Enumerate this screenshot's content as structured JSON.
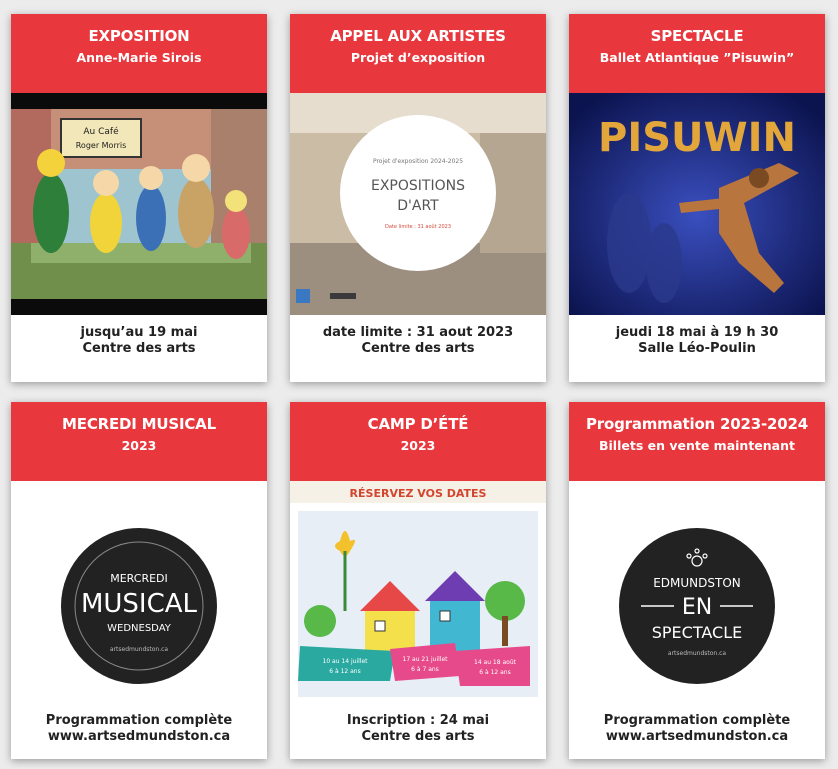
{
  "colors": {
    "header_red": "#e8373d",
    "background": "#ececec"
  },
  "cards": [
    {
      "title": "EXPOSITION",
      "subtitle": "Anne-Marie Sirois",
      "footer": [
        "jusqu’au 19 mai",
        "Centre des arts"
      ],
      "image": "cartoon-illustration",
      "image_text": [
        "Au Café",
        "Roger Morris"
      ]
    },
    {
      "title": "APPEL AUX ARTISTES",
      "subtitle": "Projet d’exposition",
      "footer": [
        "date limite : 31 aout 2023",
        "Centre des arts"
      ],
      "image": "gallery-room-photo",
      "image_text": [
        "Projet d'exposition 2024-2025",
        "EXPOSITIONS",
        "D'ART",
        "Date limite : 31 août 2023"
      ]
    },
    {
      "title": "SPECTACLE",
      "subtitle": "Ballet Atlantique ”Pisuwin”",
      "footer": [
        "jeudi 18 mai à 19 h 30",
        "Salle Léo-Poulin"
      ],
      "image": "ballet-dancer-poster",
      "image_text": [
        "PISUWIN"
      ]
    },
    {
      "title": "MECREDI MUSICAL",
      "subtitle": "2023",
      "footer": [
        "Programmation complète",
        "www.artsedmundston.ca"
      ],
      "image": "mercredi-musical-logo",
      "image_text": [
        "MERCREDI",
        "MUSICAL",
        "WEDNESDAY",
        "artsedmundston.ca"
      ]
    },
    {
      "title": "CAMP D’ÉTÉ",
      "subtitle": "2023",
      "footer": [
        "Inscription : 24 mai",
        "Centre des arts"
      ],
      "image": "summer-camp-drawing",
      "image_text": [
        "RÉSERVEZ VOS DATES",
        "10 au 14 juillet",
        "6 à 12 ans",
        "17 au 21 juillet",
        "6 à 7 ans",
        "14 au 18 août",
        "6 à 12 ans"
      ]
    },
    {
      "title": "Programmation 2023-2024",
      "subtitle": "Billets en vente maintenant",
      "footer": [
        "Programmation complète",
        "www.artsedmundston.ca"
      ],
      "image": "edmundston-en-spectacle-logo",
      "image_text": [
        "EDMUNDSTON",
        "EN",
        "SPECTACLE",
        "artsedmundston.ca"
      ]
    }
  ]
}
